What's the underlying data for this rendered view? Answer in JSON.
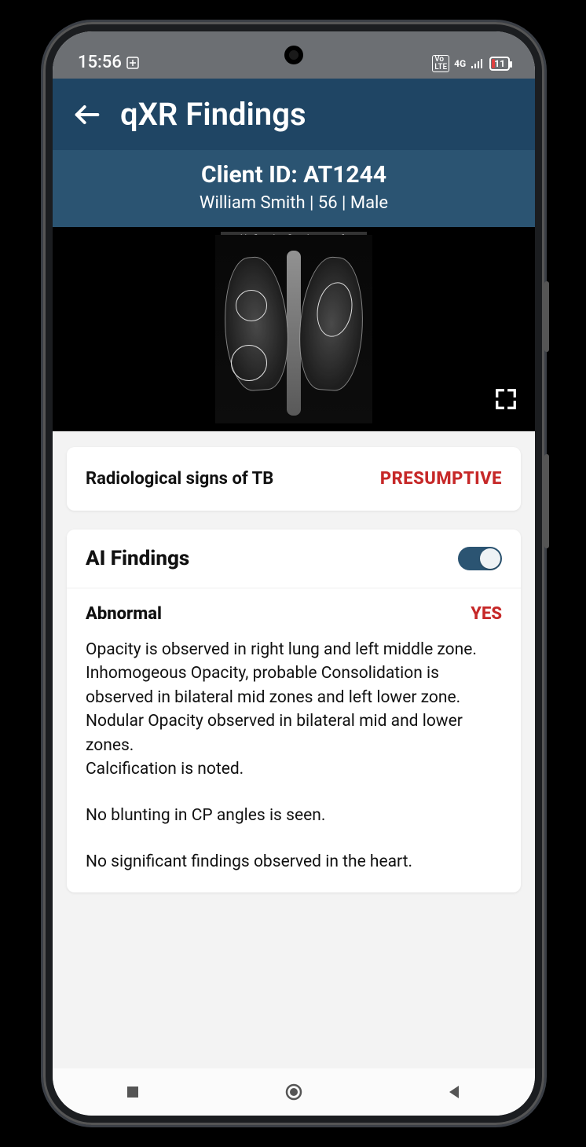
{
  "statusbar": {
    "time": "15:56",
    "network_label": "4G",
    "volte_label": "Vo\nLTE",
    "battery_pct": "11"
  },
  "header": {
    "title": "qXR Findings"
  },
  "client": {
    "id_label": "Client ID: AT1244",
    "name": "William Smith",
    "age": "56",
    "sex": "Male",
    "meta_line": "William Smith | 56 | Male"
  },
  "xray": {
    "overlay_label": "Radiological signs of TB"
  },
  "result": {
    "label": "Radiological signs of TB",
    "value": "PRESUMPTIVE"
  },
  "ai_findings": {
    "section_title": "AI Findings",
    "toggle_on": true,
    "abnormal_label": "Abnormal",
    "abnormal_value": "YES",
    "paragraphs": [
      "Opacity is observed in right lung and left middle zone.",
      "Inhomogeous Opacity, probable Consolidation is observed in bilateral mid zones and left lower zone.",
      "Nodular Opacity observed in bilateral mid and lower zones.",
      "Calcification is noted.",
      "",
      "No blunting in CP angles is seen.",
      "",
      "No significant findings observed in the heart."
    ]
  },
  "colors": {
    "brand": "#2b5472",
    "brand_dark": "#1f4564",
    "alert": "#c62828"
  }
}
